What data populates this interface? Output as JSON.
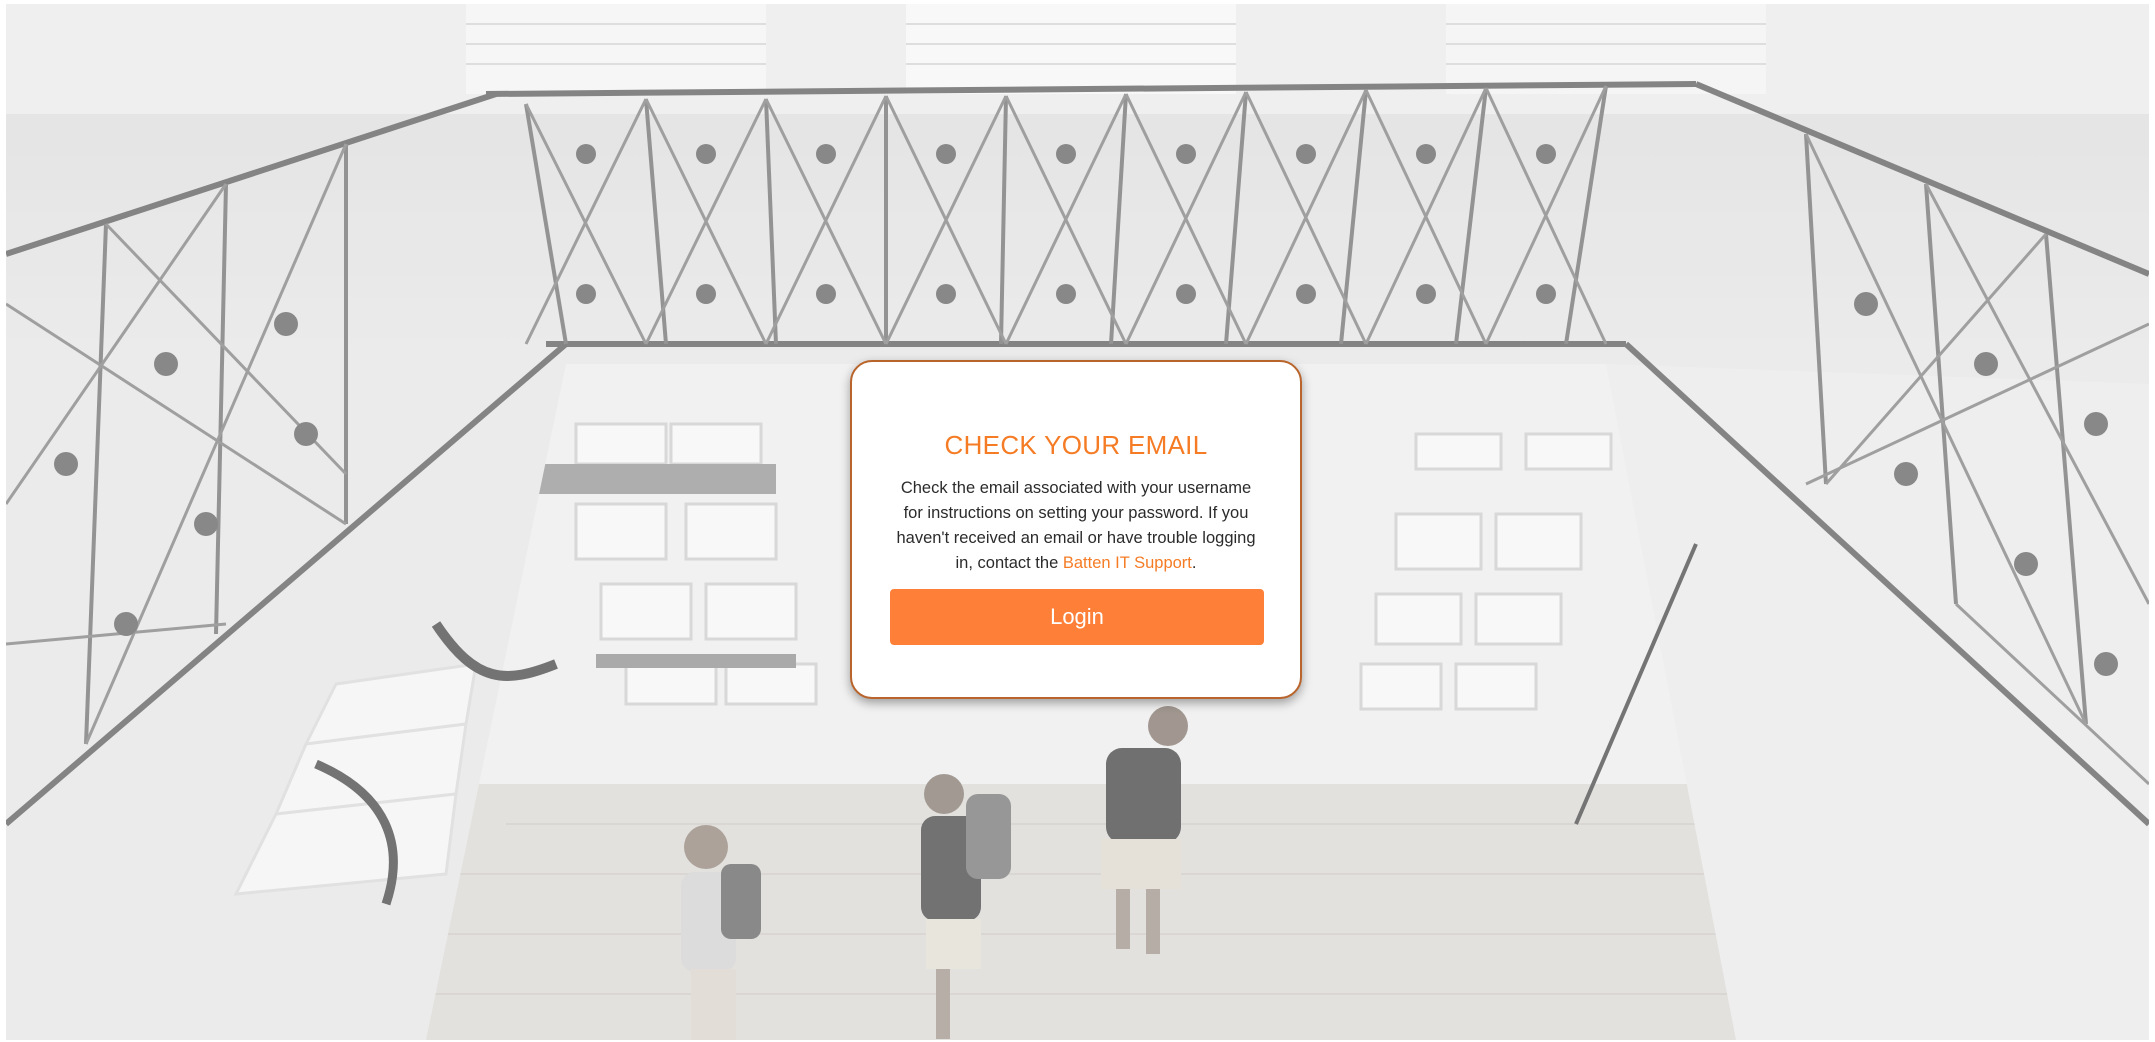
{
  "dialog": {
    "title": "CHECK YOUR EMAIL",
    "message_before_link": "Check the email associated with your username for instructions on setting your password. If you haven't received an email or have trouble logging in, contact the ",
    "support_link_label": "Batten IT Support",
    "message_after_link": ".",
    "login_button_label": "Login"
  },
  "colors": {
    "accent": "#f57c25",
    "button": "#fe8038",
    "card_border": "#b8642a"
  }
}
